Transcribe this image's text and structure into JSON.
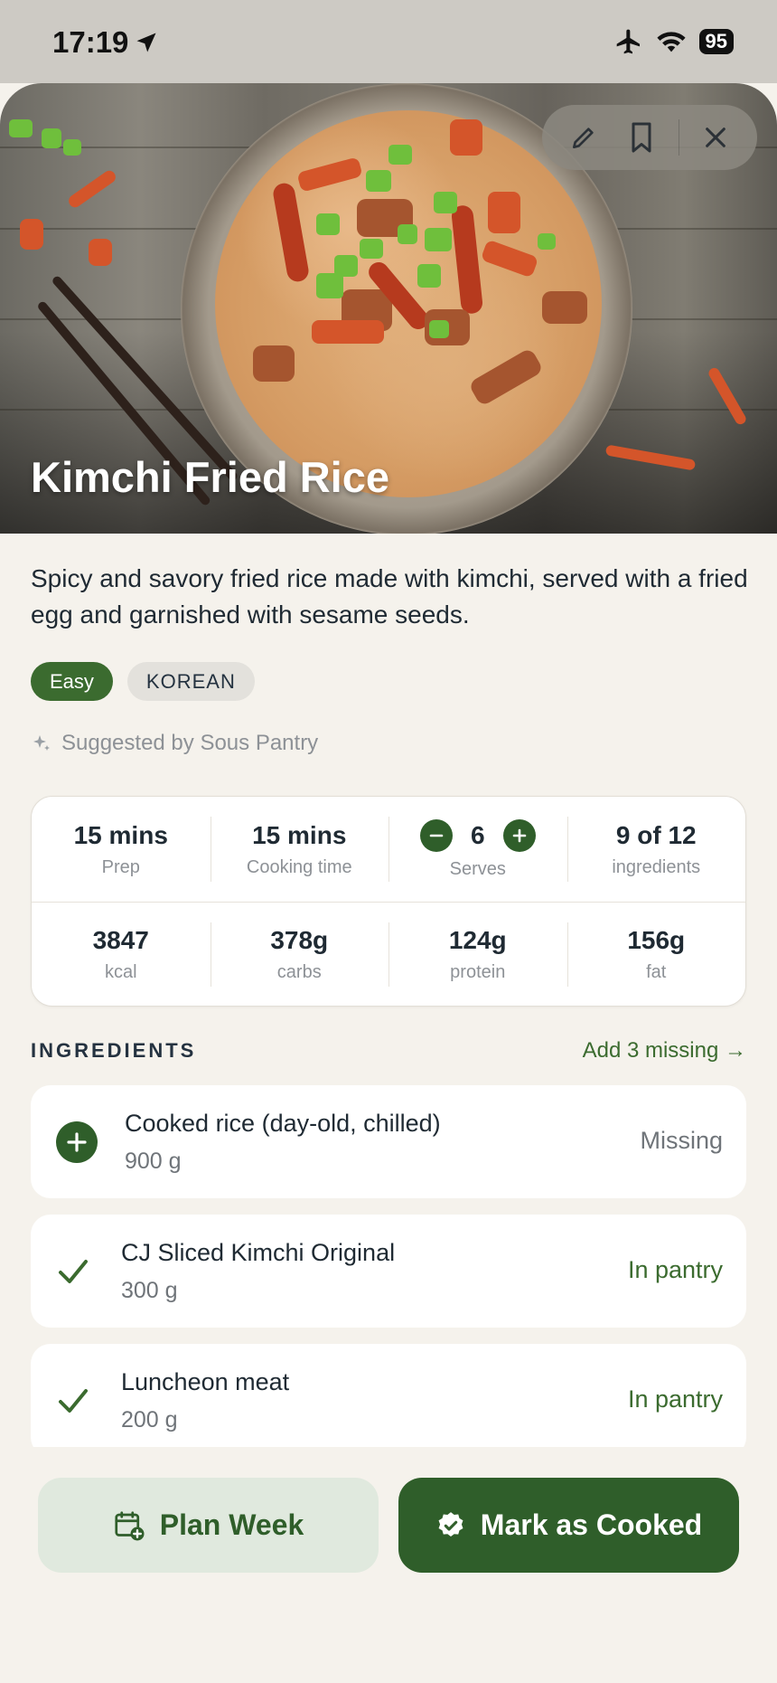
{
  "status_bar": {
    "time": "17:19",
    "battery": "95",
    "icons": [
      "location-arrow-icon",
      "airplane-icon",
      "wifi-icon",
      "battery-icon"
    ]
  },
  "hero": {
    "title": "Kimchi Fried Rice",
    "actions": [
      "edit-icon",
      "bookmark-icon",
      "close-icon"
    ]
  },
  "recipe": {
    "description": "Spicy and savory fried rice made with kimchi, served with a fried egg and garnished with sesame seeds.",
    "tags": {
      "difficulty": "Easy",
      "cuisine": "KOREAN"
    },
    "suggested_by": "Suggested by Sous Pantry"
  },
  "stats": {
    "prep": {
      "value": "15 mins",
      "label": "Prep"
    },
    "cooking": {
      "value": "15 mins",
      "label": "Cooking time"
    },
    "serves": {
      "value": "6",
      "label": "Serves"
    },
    "ingredients": {
      "value": "9 of 12",
      "label": "ingredients"
    },
    "kcal": {
      "value": "3847",
      "label": "kcal"
    },
    "carbs": {
      "value": "378g",
      "label": "carbs"
    },
    "protein": {
      "value": "124g",
      "label": "protein"
    },
    "fat": {
      "value": "156g",
      "label": "fat"
    }
  },
  "ingredients_section": {
    "title": "INGREDIENTS",
    "add_missing": "Add 3 missing →",
    "items": [
      {
        "name": "Cooked rice (day-old, chilled)",
        "qty": "900 g",
        "status": "Missing",
        "icon": "add-circle-icon"
      },
      {
        "name": "CJ Sliced Kimchi Original",
        "qty": "300 g",
        "status": "In pantry",
        "icon": "check-icon"
      },
      {
        "name": "Luncheon meat",
        "qty": "200 g",
        "status": "In pantry",
        "icon": "check-icon"
      }
    ]
  },
  "actions": {
    "plan_week": "Plan Week",
    "mark_cooked": "Mark as Cooked"
  },
  "colors": {
    "accent": "#2f5e2a",
    "background": "#f5f2ec",
    "muted_text": "#8d9196"
  }
}
